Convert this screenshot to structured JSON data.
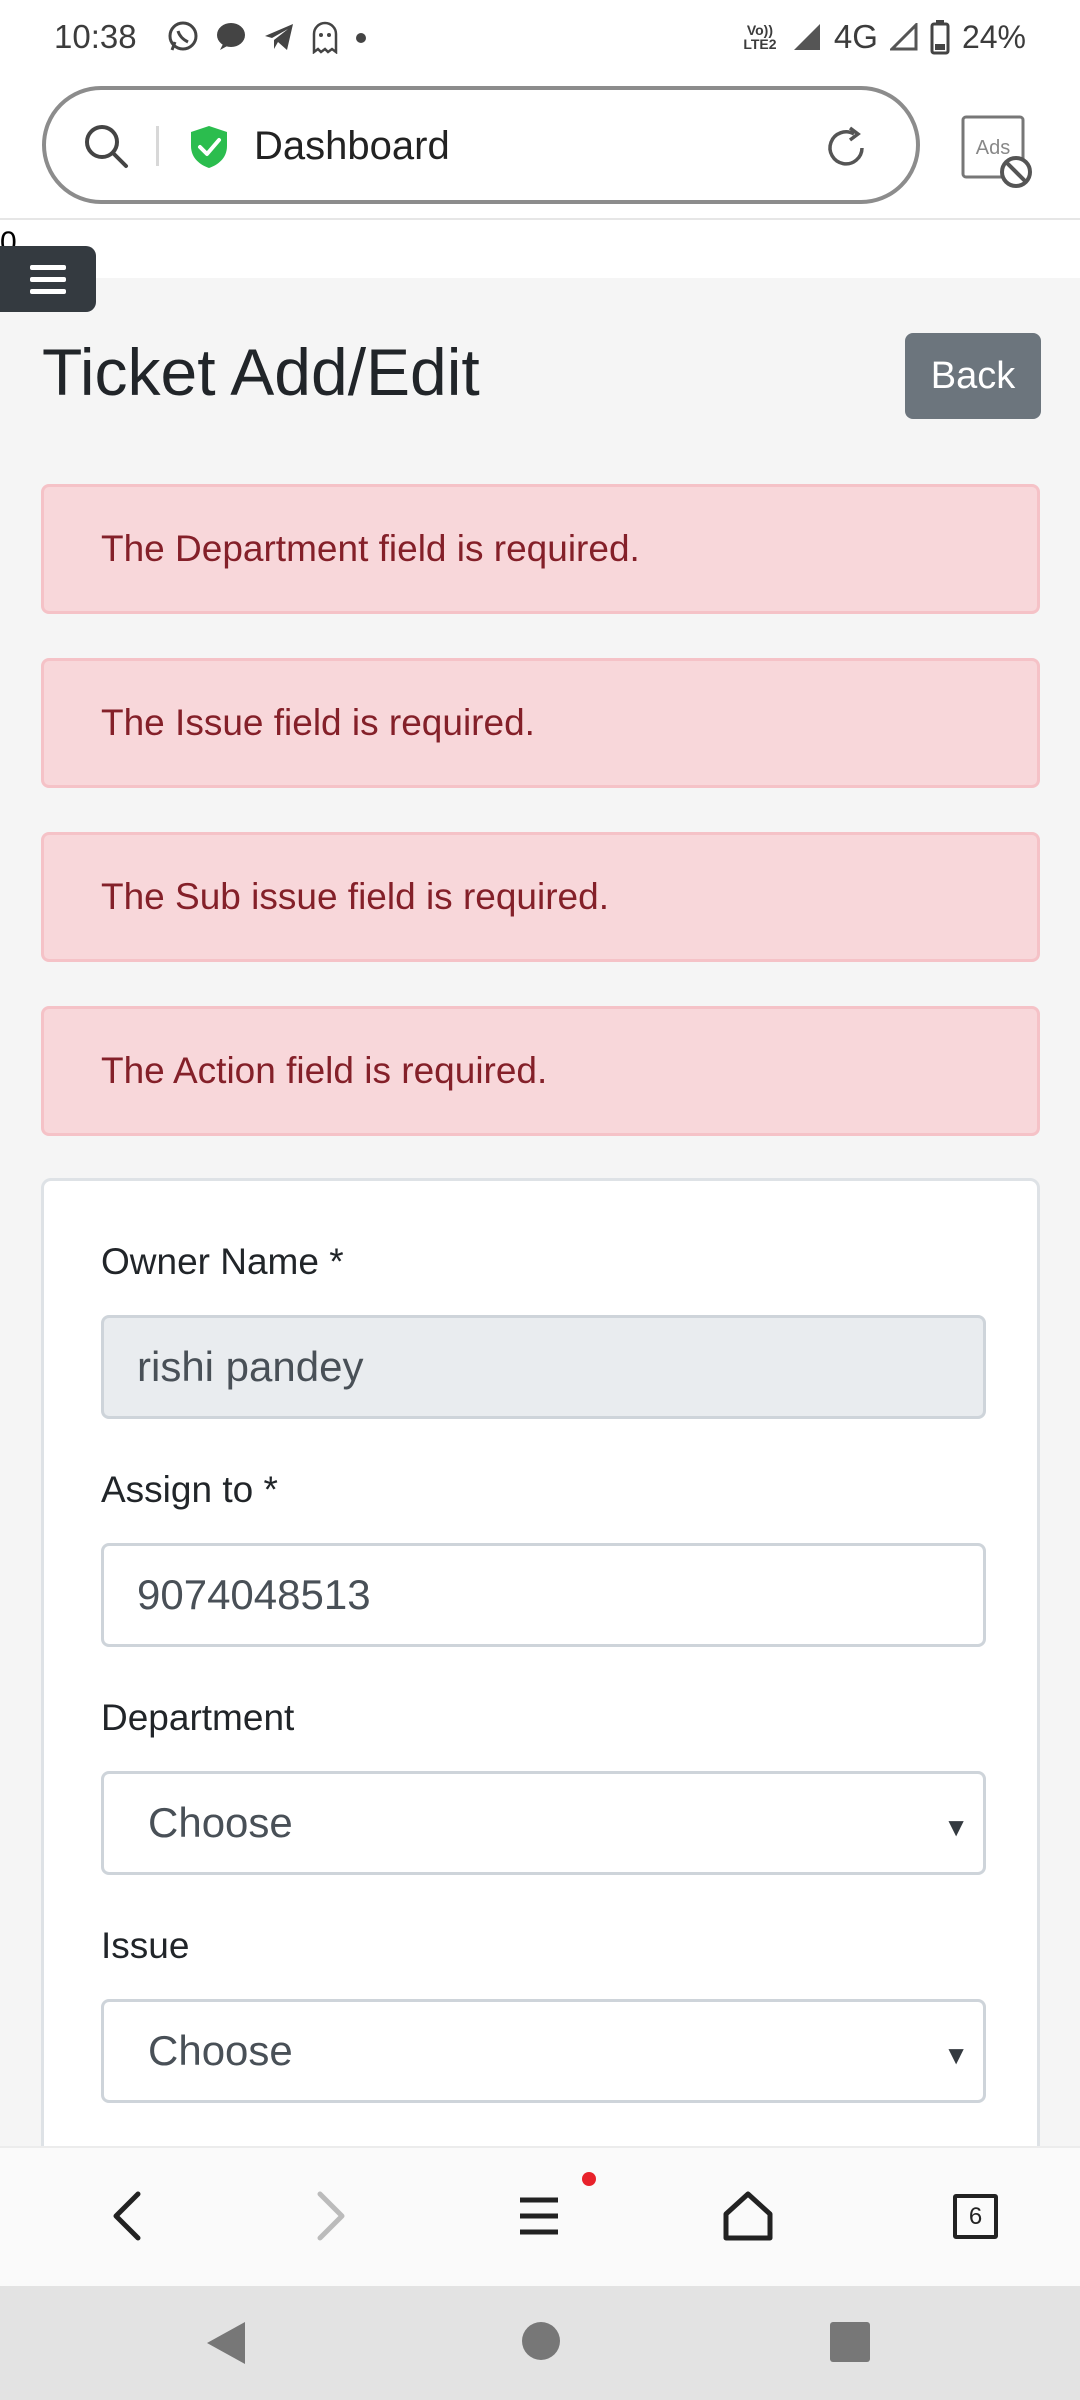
{
  "status_bar": {
    "time": "10:38",
    "network_label": "4G",
    "volte_top": "Vo))",
    "volte_bottom": "LTE2",
    "battery": "24%",
    "app_icons": [
      "whatsapp-icon",
      "chat-icon",
      "telegram-icon",
      "ghost-icon",
      "dot-icon"
    ]
  },
  "browser": {
    "title": "Dashboard",
    "ads_label": "Ads",
    "tab_count": "6"
  },
  "page": {
    "stray_text": "0",
    "title": "Ticket Add/Edit",
    "back_label": "Back"
  },
  "alerts": [
    "The Department field is required.",
    "The Issue field is required.",
    "The Sub issue field is required.",
    "The Action field is required."
  ],
  "form": {
    "owner_label": "Owner Name *",
    "owner_value": "rishi pandey",
    "assign_label": "Assign to *",
    "assign_value": "9074048513",
    "department_label": "Department",
    "department_value": "Choose",
    "issue_label": "Issue",
    "issue_value": "Choose"
  },
  "colors": {
    "alert_bg": "#f8d7da",
    "alert_text": "#842029",
    "back_button": "#6c757d",
    "secure_shield": "#2bbd4e"
  }
}
